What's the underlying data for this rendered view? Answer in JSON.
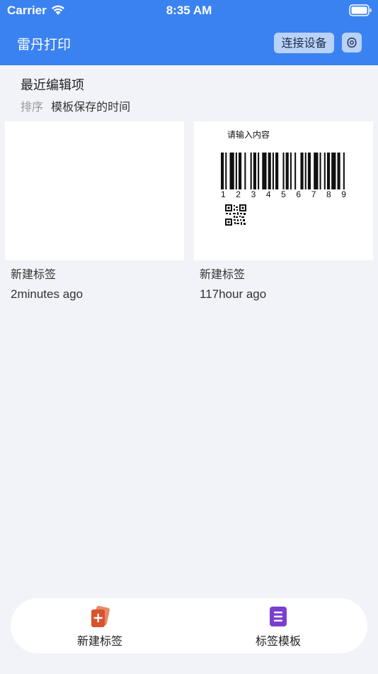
{
  "status_bar": {
    "carrier": "Carrier",
    "time": "8:35 AM"
  },
  "nav": {
    "title": "雷丹打印",
    "connect_label": "连接设备",
    "background_color": "#3b82f1"
  },
  "section": {
    "title": "最近编辑项",
    "sort_label": "排序",
    "sort_value": "模板保存的时间"
  },
  "cards": [
    {
      "name": "新建标签",
      "time": "2minutes ago"
    },
    {
      "name": "新建标签",
      "time": "117hour ago",
      "preview": {
        "text": "请输入内容",
        "barcode_digits": [
          "1",
          "2",
          "3",
          "4",
          "5",
          "6",
          "7",
          "8",
          "9"
        ]
      }
    }
  ],
  "tabs": [
    {
      "label": "新建标签",
      "icon": "new-label-icon",
      "color": "#d9532c"
    },
    {
      "label": "标签模板",
      "icon": "template-icon",
      "color": "#7b3fd0"
    }
  ]
}
